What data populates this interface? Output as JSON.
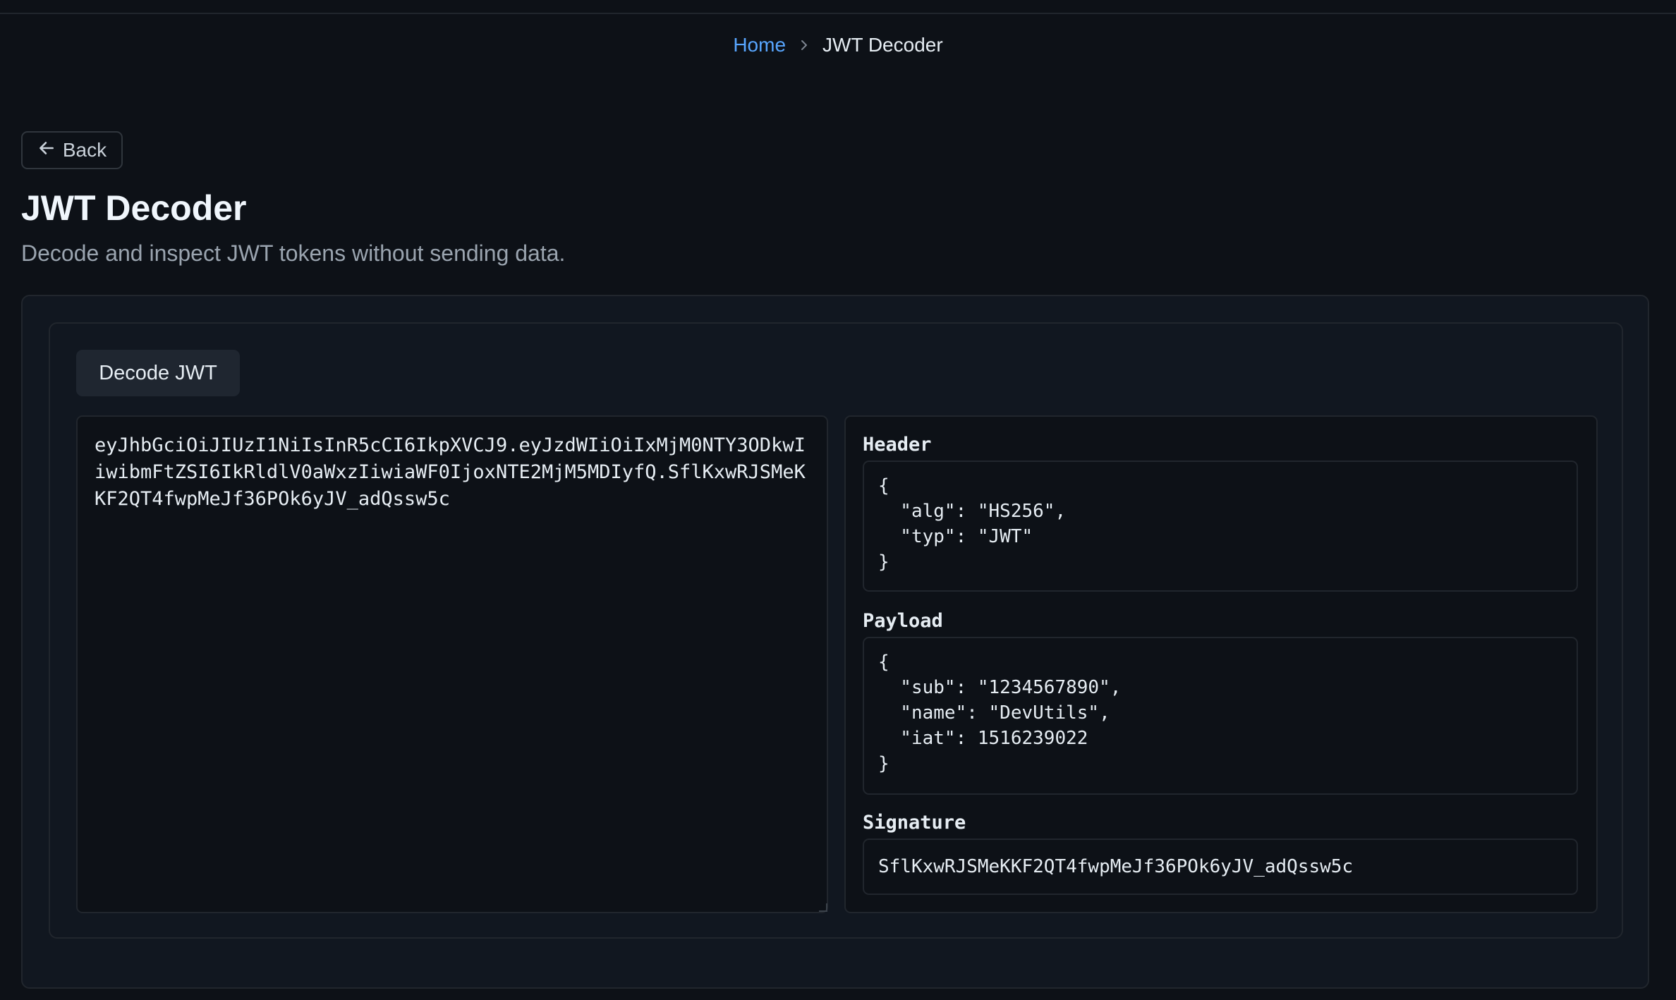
{
  "breadcrumb": {
    "home": "Home",
    "current": "JWT Decoder"
  },
  "back": {
    "label": "Back"
  },
  "page": {
    "title": "JWT Decoder",
    "subtitle": "Decode and inspect JWT tokens without sending data."
  },
  "tabs": {
    "decode_label": "Decode JWT"
  },
  "input": {
    "token": "eyJhbGciOiJIUzI1NiIsInR5cCI6IkpXVCJ9.eyJzdWIiOiIxMjM0NTY3ODkwIiwibmFtZSI6IkRldlV0aWxzIiwiaWF0IjoxNTE2MjM5MDIyfQ.SflKxwRJSMeKKF2QT4fwpMeJf36POk6yJV_adQssw5c"
  },
  "output": {
    "header_label": "Header",
    "header_json": "{\n  \"alg\": \"HS256\",\n  \"typ\": \"JWT\"\n}",
    "payload_label": "Payload",
    "payload_json": "{\n  \"sub\": \"1234567890\",\n  \"name\": \"DevUtils\",\n  \"iat\": 1516239022\n}",
    "signature_label": "Signature",
    "signature_value": "SflKxwRJSMeKKF2QT4fwpMeJf36POk6yJV_adQssw5c"
  },
  "colors": {
    "background": "#0d1117",
    "link": "#58a6ff",
    "card": "#111720",
    "tab": "#1f2630",
    "border": "#21262d"
  }
}
